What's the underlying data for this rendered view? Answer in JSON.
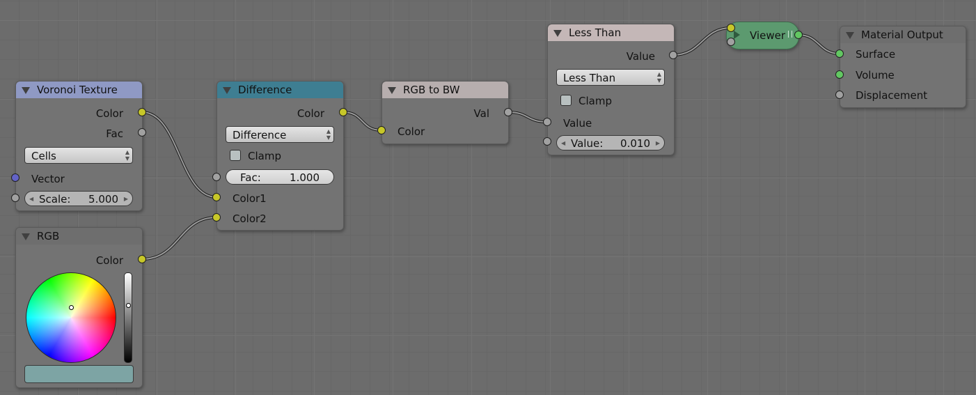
{
  "colors": {
    "background": "#6c6c6c",
    "node_body": "#737373",
    "header_voronoi": "#8f99c4",
    "header_difference": "#3e7e92",
    "header_rgb_to_bw": "#b7aeae",
    "header_less_than": "#c4b7b7",
    "header_rgb": "#6e6e6e",
    "header_output": "#6e6e6e",
    "viewer": "#5c9a6f",
    "color_socket": "#c7c729",
    "float_socket": "#a1a1a1",
    "vector_socket": "#6363c7",
    "shader_socket": "#62c762",
    "rgb_value": "#7da4a4"
  },
  "nodes": {
    "voronoi": {
      "title": "Voronoi Texture",
      "outputs": [
        "Color",
        "Fac"
      ],
      "coloring": "Cells",
      "inputs": {
        "vector": "Vector"
      },
      "scale": {
        "label": "Scale:",
        "value": "5.000"
      }
    },
    "rgb": {
      "title": "RGB",
      "output": "Color"
    },
    "difference": {
      "title": "Difference",
      "output": "Color",
      "blend_type": "Difference",
      "clamp_label": "Clamp",
      "fac": {
        "label": "Fac:",
        "value": "1.000"
      },
      "inputs": [
        "Color1",
        "Color2"
      ]
    },
    "rgb_to_bw": {
      "title": "RGB to BW",
      "output": "Val",
      "input": "Color"
    },
    "less_than": {
      "title": "Less Than",
      "output": "Value",
      "operation": "Less Than",
      "clamp_label": "Clamp",
      "input": "Value",
      "value_field": {
        "label": "Value:",
        "value": "0.010"
      }
    },
    "viewer": {
      "title": "Viewer"
    },
    "material_output": {
      "title": "Material Output",
      "inputs": [
        "Surface",
        "Volume",
        "Displacement"
      ]
    }
  },
  "links": [
    {
      "from": "voronoi.color",
      "to": "difference.color1"
    },
    {
      "from": "rgb.color",
      "to": "difference.color2"
    },
    {
      "from": "difference.color",
      "to": "rgb_to_bw.color"
    },
    {
      "from": "rgb_to_bw.val",
      "to": "less_than.value"
    },
    {
      "from": "less_than.value",
      "to": "viewer.input"
    },
    {
      "from": "viewer.output",
      "to": "material_output.surface"
    }
  ]
}
